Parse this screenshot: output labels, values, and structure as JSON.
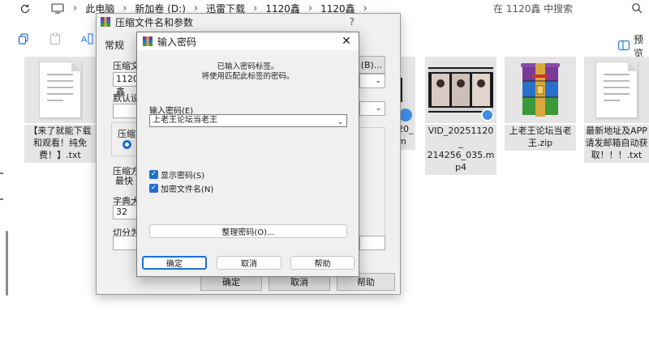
{
  "address": {
    "crumbs": [
      "此电脑",
      "新加卷 (D:)",
      "迅雷下载",
      "1120鑫",
      "1120鑫"
    ],
    "search_placeholder": "在 1120鑫 中搜索"
  },
  "toolbar": {
    "preview_label": "预览"
  },
  "files": [
    {
      "name": "【来了就能下载和观看！纯免费！】.txt",
      "type": "txt"
    },
    {
      "name": "VID_20251120_214256_035.mp4",
      "type": "video",
      "display": "VID_20251120_\n214256_035.m\np4"
    },
    {
      "name": "上老王论坛当老王.zip",
      "type": "zip",
      "display": "上老王论坛当老\n王.zip"
    },
    {
      "name": "最新地址及APP请发邮箱自动获取！！！.txt",
      "type": "txt",
      "display": "最新地址及APP\n请发邮箱自动获\n取！！！.txt"
    }
  ],
  "partial_file": {
    "lines": [
      "20_",
      "m"
    ]
  },
  "back_dialog": {
    "title": "压缩文件名和参数",
    "help": "?",
    "tab_general": "常规",
    "label_archive_name": "压缩文",
    "archive_name_value": "1120鑫",
    "browse_label": "(B)...",
    "label_default": "默认设",
    "label_format": "压缩文",
    "label_method": "压缩方",
    "method_value": "最快",
    "label_dict": "字典大",
    "dict_value": "32",
    "label_split": "切分为",
    "ok_label": "确定",
    "cancel_label": "取消",
    "help_label": "帮助"
  },
  "password_dialog": {
    "title": "输入密码",
    "info_line1": "已输入密码标签。",
    "info_line2": "将使用匹配此标签的密码。",
    "input_label": "输入密码(E)",
    "password_value": "上老王论坛当老王",
    "show_password": "显示密码(S)",
    "encrypt_filenames": "加密文件名(N)",
    "organize_label": "整理密码(O)...",
    "ok_label": "确定",
    "cancel_label": "取消",
    "help_label": "帮助"
  },
  "colors": {
    "accent": "#1f6fce",
    "selection": "#e5e5e5"
  }
}
